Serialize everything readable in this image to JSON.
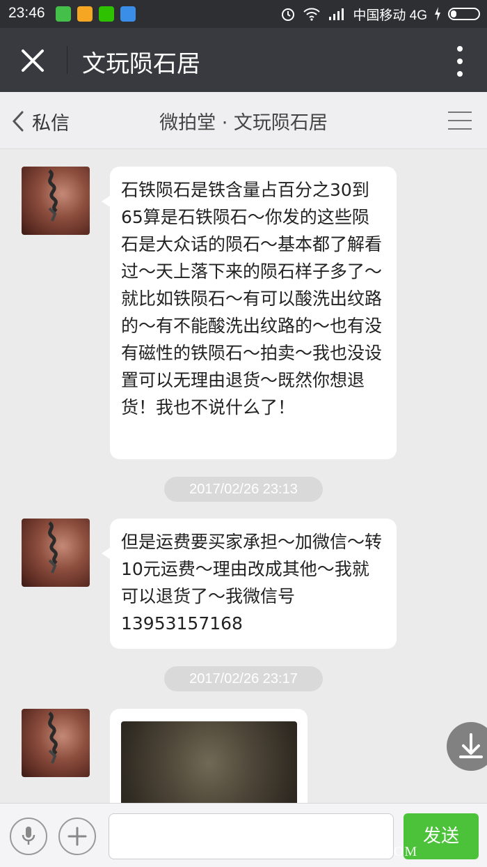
{
  "status_bar": {
    "time": "23:46",
    "carrier": "中国移动 4G"
  },
  "title_bar": {
    "title": "文玩陨石居"
  },
  "sub_header": {
    "back_label": "私信",
    "title": "微拍堂 · 文玩陨石居"
  },
  "messages": [
    {
      "text": "石铁陨石是铁含量占百分之30到65算是石铁陨石～你发的这些陨石是大众话的陨石～基本都了解看过～天上落下来的陨石样子多了～就比如铁陨石～有可以酸洗出纹路的～有不能酸洗出纹路的～也有没有磁性的铁陨石～拍卖～我也没设置可以无理由退货～既然你想退货！我也不说什么了！"
    },
    {
      "timestamp": "2017/02/26 23:13"
    },
    {
      "text": "但是运费要买家承担～加微信～转10元运费～理由改成其他～我就可以退货了～我微信号13953157168"
    },
    {
      "timestamp": "2017/02/26 23:17"
    }
  ],
  "input_bar": {
    "send_label": "发送"
  },
  "watermark": "JUSHIUNSHI.COM",
  "colors": {
    "status_bar": "#2e2f33",
    "title_bar": "#393a3f",
    "chat_bg": "#ebebeb",
    "send_button": "#4cc13a"
  }
}
